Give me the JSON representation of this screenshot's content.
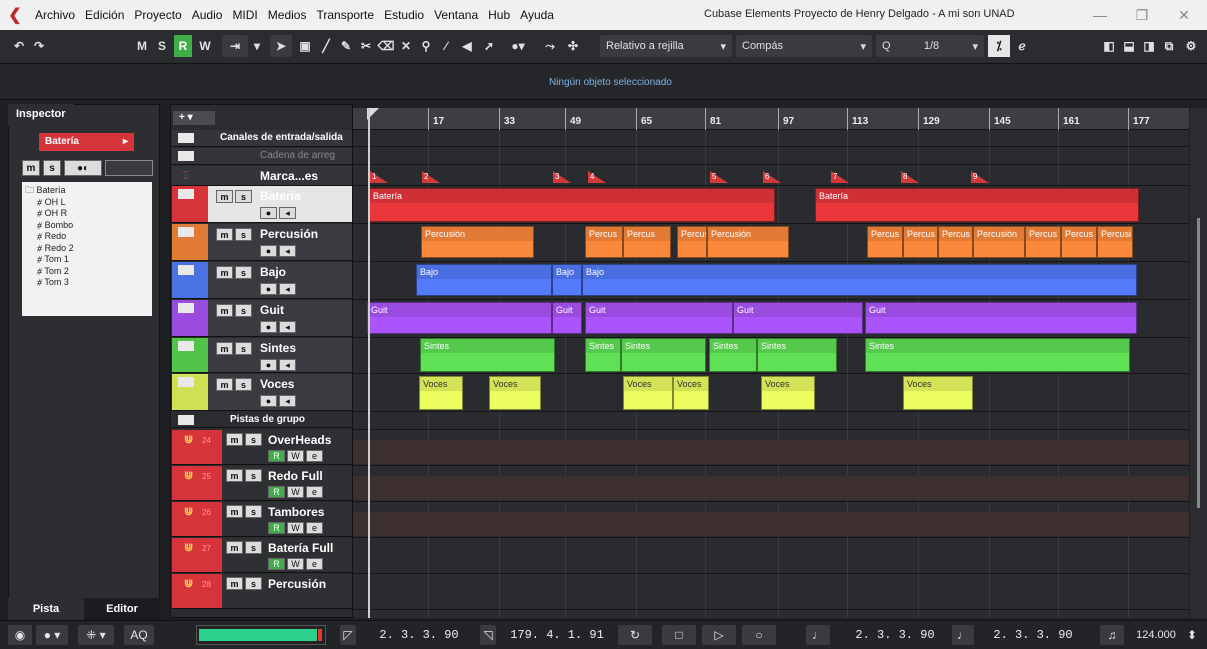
{
  "menu": {
    "items": [
      "Archivo",
      "Edición",
      "Proyecto",
      "Audio",
      "MIDI",
      "Medios",
      "Transporte",
      "Estudio",
      "Ventana",
      "Hub",
      "Ayuda"
    ],
    "title": "Cubase Elements Proyecto de Henry Delgado - A mi son UNAD"
  },
  "toolbar": {
    "m": "M",
    "s": "S",
    "r": "R",
    "w": "W",
    "snap_mode": "Relativo a rejilla",
    "grid_type": "Compás",
    "quantize_label": "Q",
    "quantize_value": "1/8"
  },
  "infoline": {
    "text": "Ningún objeto seleccionado"
  },
  "inspector": {
    "tab": "Inspector",
    "track": "Batería",
    "tree": [
      "Batería",
      "OH L",
      "OH R",
      "Bombo",
      "Redo",
      "Redo 2",
      "Tom 1",
      "Tom 2",
      "Tom 3"
    ],
    "bottom_tabs": [
      "Pista",
      "Editor"
    ]
  },
  "tracks": {
    "io": "Canales de entrada/salida",
    "chain": "Cadena de arreg",
    "markers": "Marca...es",
    "list": [
      {
        "name": "Batería",
        "color": "#d6343a"
      },
      {
        "name": "Percusión",
        "color": "#e07a35"
      },
      {
        "name": "Bajo",
        "color": "#4a72e0"
      },
      {
        "name": "Guit",
        "color": "#9a4be0"
      },
      {
        "name": "Sintes",
        "color": "#53c44a"
      },
      {
        "name": "Voces",
        "color": "#d0e054"
      }
    ],
    "group_folder": "Pistas de grupo",
    "groups": [
      {
        "num": "24",
        "name": "OverHeads"
      },
      {
        "num": "25",
        "name": "Redo Full"
      },
      {
        "num": "26",
        "name": "Tambores"
      },
      {
        "num": "27",
        "name": "Batería Full"
      },
      {
        "num": "28",
        "name": "Percusión"
      }
    ]
  },
  "ruler": {
    "bars": [
      "17",
      "33",
      "49",
      "65",
      "81",
      "97",
      "113",
      "129",
      "145",
      "161",
      "177"
    ]
  },
  "markers": [
    "1",
    "2",
    "3",
    "4",
    "5",
    "6",
    "7",
    "8",
    "9"
  ],
  "events": {
    "bateria": [
      "Batería",
      "Batería"
    ],
    "percusion": [
      "Percusión",
      "Percus",
      "Percus",
      "Percus",
      "Percusión",
      "Percus",
      "Percus",
      "Percus",
      "Percusión",
      "Percus",
      "Percus",
      "Percusi"
    ],
    "bajo": [
      "Bajo",
      "Bajo",
      "Bajo"
    ],
    "guit": [
      "Guit",
      "Guit",
      "Guit",
      "Guit",
      "Guit"
    ],
    "sintes": [
      "Sintes",
      "Sintes",
      "Sintes",
      "Sintes",
      "Sintes",
      "Sintes"
    ],
    "voces": [
      "Voces",
      "Voces",
      "Voces",
      "Voces",
      "Voces",
      "Voces"
    ]
  },
  "transport": {
    "aq": "AQ",
    "left_locator": "2. 3. 3. 90",
    "right_locator": "179. 4. 1. 91",
    "pos1": "2. 3. 3. 90",
    "pos2": "2. 3. 3. 90",
    "tempo": "124.000"
  }
}
